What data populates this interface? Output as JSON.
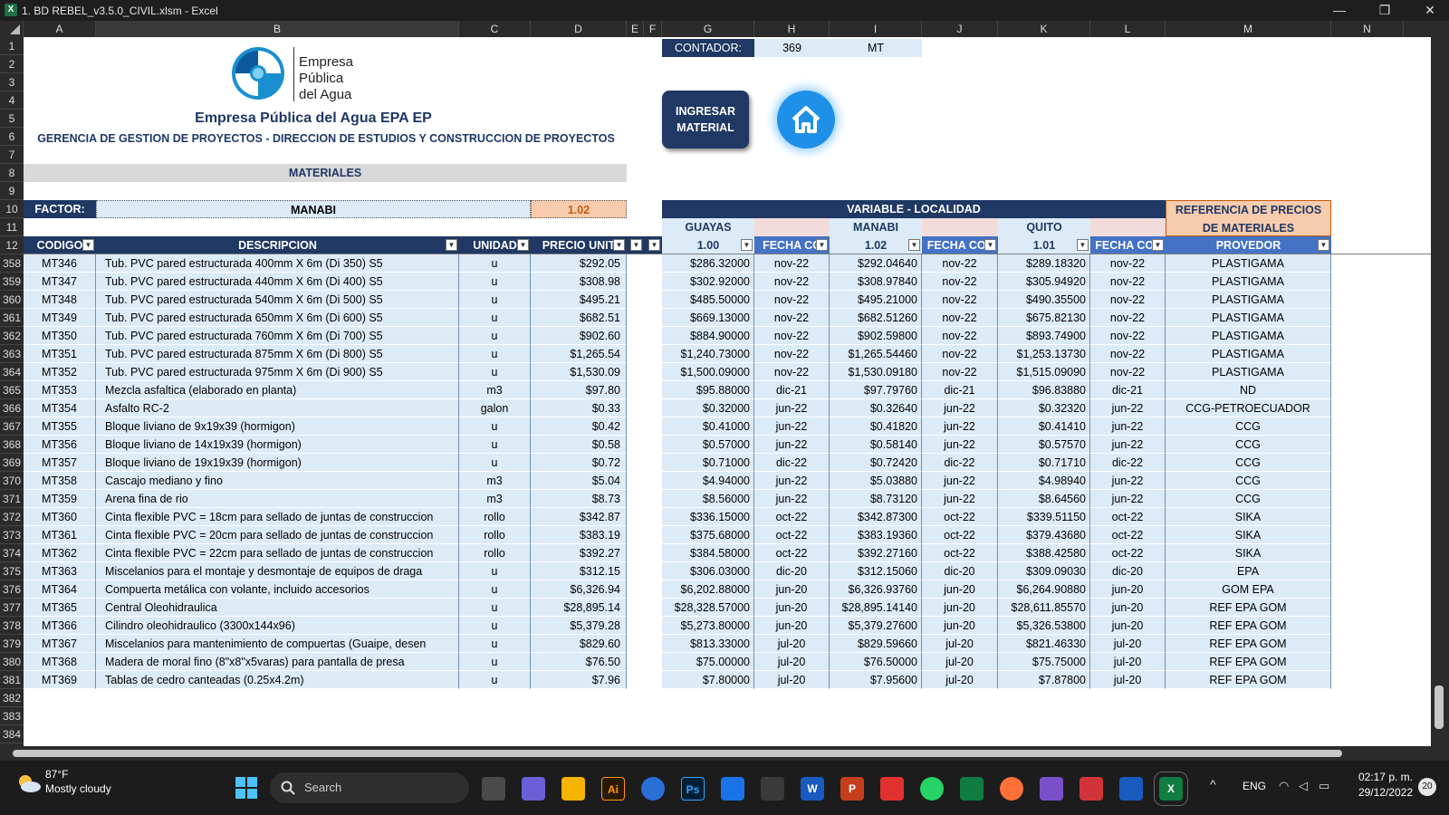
{
  "window": {
    "title": "1. BD REBEL_v3.5.0_CIVIL.xlsm - Excel",
    "app_badge": "X",
    "minimize": "—",
    "restore": "❐",
    "close": "✕"
  },
  "column_letters": [
    "A",
    "B",
    "C",
    "D",
    "E",
    "F",
    "G",
    "H",
    "I",
    "J",
    "K",
    "L",
    "M",
    "N"
  ],
  "top_rows": [
    "1",
    "2",
    "3",
    "4",
    "5",
    "6",
    "7",
    "8",
    "9",
    "10",
    "11",
    "12"
  ],
  "header": {
    "logo_line1": "Empresa",
    "logo_line2": "Pública",
    "logo_line3": "del Agua",
    "company": "Empresa Pública del Agua EPA EP",
    "subtitle": "GERENCIA DE GESTION DE PROYECTOS - DIRECCION DE ESTUDIOS Y CONSTRUCCION DE PROYECTOS",
    "section": "MATERIALES",
    "factor_label": "FACTOR:",
    "factor_region": "MANABI",
    "factor_value": "1.02",
    "contador_label": "CONTADOR:",
    "contador_value": "369",
    "contador_prefix": "MT",
    "ingresar_button": "INGRESAR MATERIAL",
    "variable_header": "VARIABLE - LOCALIDAD",
    "referencia_header": "REFERENCIA DE PRECIOS DE MATERIALES",
    "guayas": "GUAYAS",
    "manabi": "MANABI",
    "quito": "QUITO",
    "guayas_factor": "1.00",
    "manabi_factor": "1.02",
    "quito_factor": "1.01",
    "col_codigo": "CODIGO",
    "col_desc": "DESCRIPCION",
    "col_unidad": "UNIDAD",
    "col_precio": "PRECIO UNIT",
    "col_fecha": "FECHA COT",
    "col_fecha_g": "FECHA CO",
    "col_proveedor": "PROVEDOR",
    "filter_glyph": "▼"
  },
  "rows": [
    {
      "n": "358",
      "code": "MT346",
      "desc": "Tub. PVC pared estructurada 400mm X 6m (Di 350) S5",
      "unit": "u",
      "price": "$292.05",
      "g": "$286.32000",
      "gf": "nov-22",
      "m": "$292.04640",
      "mf": "nov-22",
      "q": "$289.18320",
      "qf": "nov-22",
      "prov": "PLASTIGAMA"
    },
    {
      "n": "359",
      "code": "MT347",
      "desc": "Tub. PVC pared estructurada 440mm X 6m (Di 400) S5",
      "unit": "u",
      "price": "$308.98",
      "g": "$302.92000",
      "gf": "nov-22",
      "m": "$308.97840",
      "mf": "nov-22",
      "q": "$305.94920",
      "qf": "nov-22",
      "prov": "PLASTIGAMA"
    },
    {
      "n": "360",
      "code": "MT348",
      "desc": "Tub. PVC pared estructurada 540mm X 6m (Di 500) S5",
      "unit": "u",
      "price": "$495.21",
      "g": "$485.50000",
      "gf": "nov-22",
      "m": "$495.21000",
      "mf": "nov-22",
      "q": "$490.35500",
      "qf": "nov-22",
      "prov": "PLASTIGAMA"
    },
    {
      "n": "361",
      "code": "MT349",
      "desc": "Tub. PVC pared estructurada 650mm X 6m (Di 600) S5",
      "unit": "u",
      "price": "$682.51",
      "g": "$669.13000",
      "gf": "nov-22",
      "m": "$682.51260",
      "mf": "nov-22",
      "q": "$675.82130",
      "qf": "nov-22",
      "prov": "PLASTIGAMA"
    },
    {
      "n": "362",
      "code": "MT350",
      "desc": "Tub. PVC pared estructurada 760mm X 6m (Di 700) S5",
      "unit": "u",
      "price": "$902.60",
      "g": "$884.90000",
      "gf": "nov-22",
      "m": "$902.59800",
      "mf": "nov-22",
      "q": "$893.74900",
      "qf": "nov-22",
      "prov": "PLASTIGAMA"
    },
    {
      "n": "363",
      "code": "MT351",
      "desc": "Tub. PVC pared estructurada 875mm X 6m (Di 800) S5",
      "unit": "u",
      "price": "$1,265.54",
      "g": "$1,240.73000",
      "gf": "nov-22",
      "m": "$1,265.54460",
      "mf": "nov-22",
      "q": "$1,253.13730",
      "qf": "nov-22",
      "prov": "PLASTIGAMA"
    },
    {
      "n": "364",
      "code": "MT352",
      "desc": "Tub. PVC pared estructurada 975mm X 6m (Di 900) S5",
      "unit": "u",
      "price": "$1,530.09",
      "g": "$1,500.09000",
      "gf": "nov-22",
      "m": "$1,530.09180",
      "mf": "nov-22",
      "q": "$1,515.09090",
      "qf": "nov-22",
      "prov": "PLASTIGAMA"
    },
    {
      "n": "365",
      "code": "MT353",
      "desc": "Mezcla asfaltica (elaborado en planta)",
      "unit": "m3",
      "price": "$97.80",
      "g": "$95.88000",
      "gf": "dic-21",
      "m": "$97.79760",
      "mf": "dic-21",
      "q": "$96.83880",
      "qf": "dic-21",
      "prov": "ND"
    },
    {
      "n": "366",
      "code": "MT354",
      "desc": "Asfalto RC-2",
      "unit": "galon",
      "price": "$0.33",
      "g": "$0.32000",
      "gf": "jun-22",
      "m": "$0.32640",
      "mf": "jun-22",
      "q": "$0.32320",
      "qf": "jun-22",
      "prov": "CCG-PETROECUADOR"
    },
    {
      "n": "367",
      "code": "MT355",
      "desc": "Bloque liviano de 9x19x39 (hormigon)",
      "unit": "u",
      "price": "$0.42",
      "g": "$0.41000",
      "gf": "jun-22",
      "m": "$0.41820",
      "mf": "jun-22",
      "q": "$0.41410",
      "qf": "jun-22",
      "prov": "CCG"
    },
    {
      "n": "368",
      "code": "MT356",
      "desc": "Bloque liviano de 14x19x39 (hormigon)",
      "unit": "u",
      "price": "$0.58",
      "g": "$0.57000",
      "gf": "jun-22",
      "m": "$0.58140",
      "mf": "jun-22",
      "q": "$0.57570",
      "qf": "jun-22",
      "prov": "CCG"
    },
    {
      "n": "369",
      "code": "MT357",
      "desc": "Bloque liviano de 19x19x39 (hormigon)",
      "unit": "u",
      "price": "$0.72",
      "g": "$0.71000",
      "gf": "dic-22",
      "m": "$0.72420",
      "mf": "dic-22",
      "q": "$0.71710",
      "qf": "dic-22",
      "prov": "CCG"
    },
    {
      "n": "370",
      "code": "MT358",
      "desc": "Cascajo mediano y fino",
      "unit": "m3",
      "price": "$5.04",
      "g": "$4.94000",
      "gf": "jun-22",
      "m": "$5.03880",
      "mf": "jun-22",
      "q": "$4.98940",
      "qf": "jun-22",
      "prov": "CCG"
    },
    {
      "n": "371",
      "code": "MT359",
      "desc": "Arena fina de rio",
      "unit": "m3",
      "price": "$8.73",
      "g": "$8.56000",
      "gf": "jun-22",
      "m": "$8.73120",
      "mf": "jun-22",
      "q": "$8.64560",
      "qf": "jun-22",
      "prov": "CCG"
    },
    {
      "n": "372",
      "code": "MT360",
      "desc": "Cinta flexible PVC = 18cm para sellado de juntas de construccion",
      "unit": "rollo",
      "price": "$342.87",
      "g": "$336.15000",
      "gf": "oct-22",
      "m": "$342.87300",
      "mf": "oct-22",
      "q": "$339.51150",
      "qf": "oct-22",
      "prov": "SIKA"
    },
    {
      "n": "373",
      "code": "MT361",
      "desc": "Cinta flexible PVC = 20cm para sellado de juntas de construccion",
      "unit": "rollo",
      "price": "$383.19",
      "g": "$375.68000",
      "gf": "oct-22",
      "m": "$383.19360",
      "mf": "oct-22",
      "q": "$379.43680",
      "qf": "oct-22",
      "prov": "SIKA"
    },
    {
      "n": "374",
      "code": "MT362",
      "desc": "Cinta flexible PVC = 22cm para sellado de juntas de construccion",
      "unit": "rollo",
      "price": "$392.27",
      "g": "$384.58000",
      "gf": "oct-22",
      "m": "$392.27160",
      "mf": "oct-22",
      "q": "$388.42580",
      "qf": "oct-22",
      "prov": "SIKA"
    },
    {
      "n": "375",
      "code": "MT363",
      "desc": "Miscelanios para el montaje y desmontaje de equipos de draga",
      "unit": "u",
      "price": "$312.15",
      "g": "$306.03000",
      "gf": "dic-20",
      "m": "$312.15060",
      "mf": "dic-20",
      "q": "$309.09030",
      "qf": "dic-20",
      "prov": "EPA"
    },
    {
      "n": "376",
      "code": "MT364",
      "desc": "Compuerta metálica con volante, incluido accesorios",
      "unit": "u",
      "price": "$6,326.94",
      "g": "$6,202.88000",
      "gf": "jun-20",
      "m": "$6,326.93760",
      "mf": "jun-20",
      "q": "$6,264.90880",
      "qf": "jun-20",
      "prov": "GOM EPA"
    },
    {
      "n": "377",
      "code": "MT365",
      "desc": "Central Oleohidraulica",
      "unit": "u",
      "price": "$28,895.14",
      "g": "$28,328.57000",
      "gf": "jun-20",
      "m": "$28,895.14140",
      "mf": "jun-20",
      "q": "$28,611.85570",
      "qf": "jun-20",
      "prov": "REF EPA GOM"
    },
    {
      "n": "378",
      "code": "MT366",
      "desc": "Cilindro oleohidraulico (3300x144x96)",
      "unit": "u",
      "price": "$5,379.28",
      "g": "$5,273.80000",
      "gf": "jun-20",
      "m": "$5,379.27600",
      "mf": "jun-20",
      "q": "$5,326.53800",
      "qf": "jun-20",
      "prov": "REF EPA GOM"
    },
    {
      "n": "379",
      "code": "MT367",
      "desc": "Miscelanios para mantenimiento de compuertas (Guaipe, desen",
      "unit": "u",
      "price": "$829.60",
      "g": "$813.33000",
      "gf": "jul-20",
      "m": "$829.59660",
      "mf": "jul-20",
      "q": "$821.46330",
      "qf": "jul-20",
      "prov": "REF EPA GOM"
    },
    {
      "n": "380",
      "code": "MT368",
      "desc": "Madera de moral fino (8\"x8\"x5varas) para pantalla de presa",
      "unit": "u",
      "price": "$76.50",
      "g": "$75.00000",
      "gf": "jul-20",
      "m": "$76.50000",
      "mf": "jul-20",
      "q": "$75.75000",
      "qf": "jul-20",
      "prov": "REF EPA GOM"
    },
    {
      "n": "381",
      "code": "MT369",
      "desc": "Tablas de cedro canteadas (0.25x4.2m)",
      "unit": "u",
      "price": "$7.96",
      "g": "$7.80000",
      "gf": "jul-20",
      "m": "$7.95600",
      "mf": "jul-20",
      "q": "$7.87800",
      "qf": "jul-20",
      "prov": "REF EPA GOM"
    }
  ],
  "empty_rows": [
    "382",
    "383",
    "384"
  ],
  "taskbar": {
    "temp": "87°F",
    "weather": "Mostly cloudy",
    "search": "Search",
    "lang": "ENG",
    "time": "02:17 p. m.",
    "date": "29/12/2022",
    "notif": "20",
    "apps": [
      "Ai",
      "Ps",
      "W",
      "P",
      "X"
    ]
  }
}
